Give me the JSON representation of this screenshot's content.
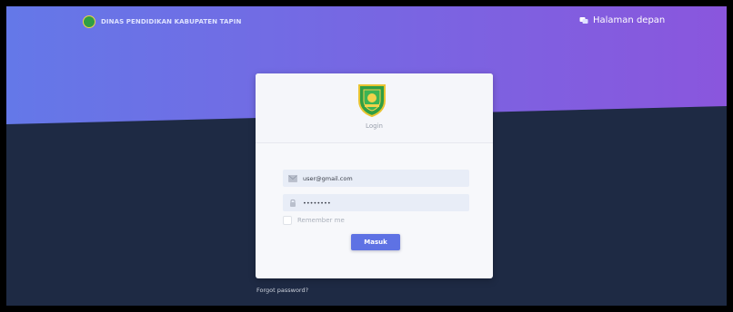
{
  "navbar": {
    "brand_text": "DINAS PENDIDIKAN KABUPATEN TAPIN",
    "home_link": "Halaman depan"
  },
  "login_card": {
    "title": "Login",
    "email_value": "user@gmail.com",
    "password_value": "••••••••",
    "remember_label": "Remember me",
    "submit_label": "Masuk"
  },
  "footer": {
    "forgot_password": "Forgot password?"
  },
  "colors": {
    "gradient_start": "#6478e8",
    "gradient_end": "#8a56dd",
    "dark_background": "#1e2a44",
    "primary_button": "#5e72e4"
  }
}
